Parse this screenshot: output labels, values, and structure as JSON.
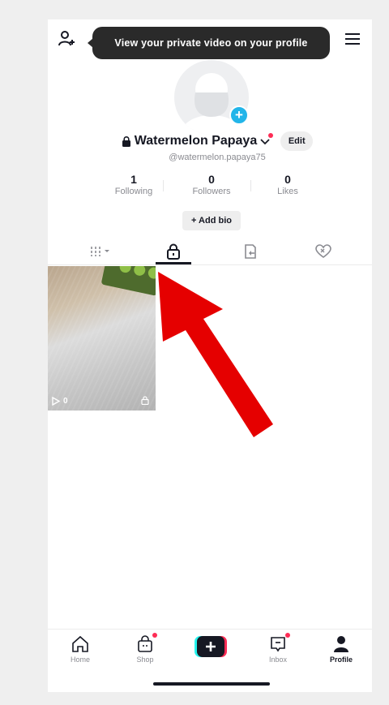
{
  "tooltip": {
    "text": "View your private video on your profile"
  },
  "header": {
    "add_user_icon": "add-user-icon",
    "menu_icon": "hamburger-menu-icon"
  },
  "profile": {
    "display_name": "Watermelon Papaya",
    "username": "@watermelon.papaya75",
    "edit_label": "Edit",
    "add_bio_label": "+ Add bio"
  },
  "stats": {
    "following": {
      "value": "1",
      "label": "Following"
    },
    "followers": {
      "value": "0",
      "label": "Followers"
    },
    "likes": {
      "value": "0",
      "label": "Likes"
    }
  },
  "tabs": [
    {
      "icon": "grid-icon",
      "active": false
    },
    {
      "icon": "lock-icon",
      "active": true
    },
    {
      "icon": "repost-icon",
      "active": false
    },
    {
      "icon": "liked-icon",
      "active": false
    }
  ],
  "videos": [
    {
      "views": "0",
      "private": true
    }
  ],
  "annotation": {
    "color": "#e50000",
    "points_to": "private-videos-tab"
  },
  "bottom_nav": {
    "home": "Home",
    "shop": "Shop",
    "inbox": "Inbox",
    "profile": "Profile"
  },
  "colors": {
    "accent": "#fe2c55",
    "blue": "#22b5e9",
    "text": "#161823",
    "secondary": "#8a8b91"
  }
}
